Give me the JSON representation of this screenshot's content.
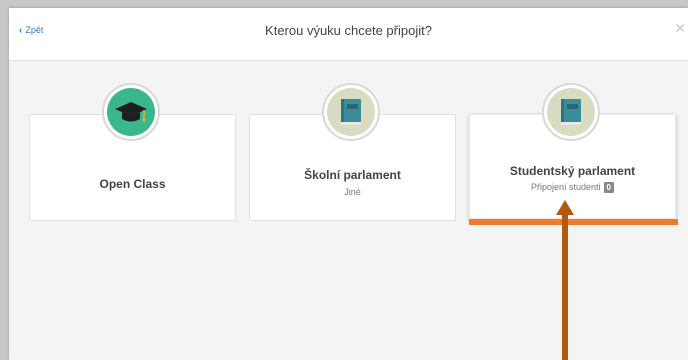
{
  "header": {
    "back_label": "Zpět",
    "title": "Kterou výuku chcete připojit?",
    "close_glyph": "✕"
  },
  "cards": [
    {
      "name": "Open Class",
      "icon": "graduation-cap-icon"
    },
    {
      "name": "Školní parlament",
      "subtitle": "Jiné",
      "icon": "book-icon"
    },
    {
      "name": "Studentský parlament",
      "subtitle": "Připojení studenti",
      "badge": "0",
      "icon": "book-icon",
      "selected": true
    }
  ],
  "colors": {
    "accent": "#f07c2a",
    "link": "#3a78c4",
    "icon_green": "#3bb78f",
    "icon_beige": "#d8dcc0",
    "book_teal": "#3d8c9a",
    "arrow": "#b35a0c"
  }
}
